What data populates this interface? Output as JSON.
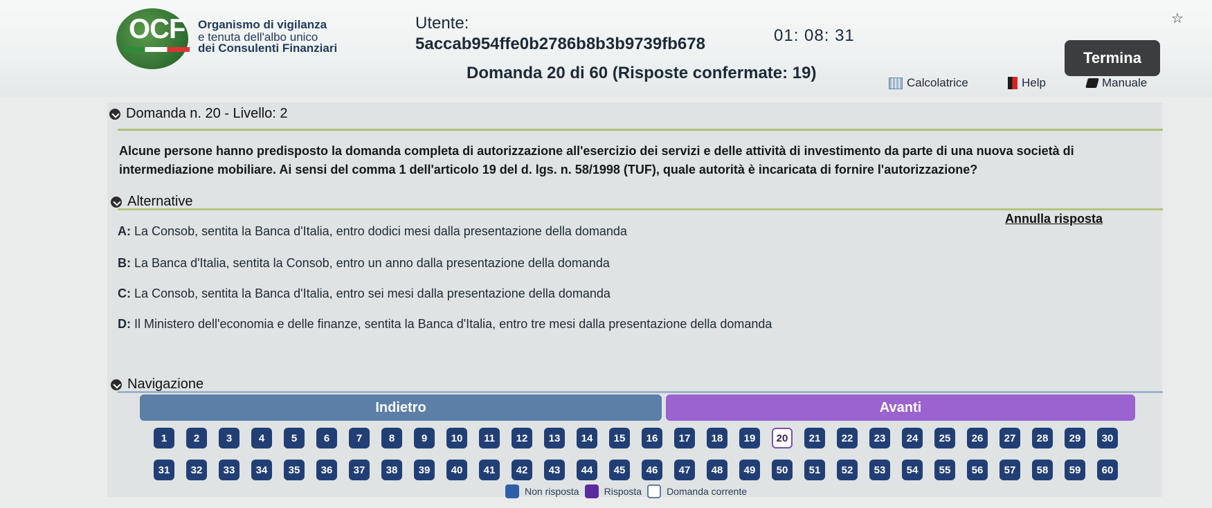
{
  "header": {
    "logo_text": "OCF",
    "org_line1": "Organismo di vigilanza",
    "org_line2": "e tenuta dell'albo unico",
    "org_line3": "dei Consulenti Finanziari",
    "user_label": "Utente:",
    "user_id": "5accab954ffe0b2786b8b3b9739fb678",
    "timer": "01: 08: 31",
    "question_count": "Domanda 20 di 60 (Risposte confermate: 19)",
    "termina_label": "Termina",
    "tools": {
      "calculator": "Calcolatrice",
      "help": "Help",
      "manual": "Manuale"
    }
  },
  "question": {
    "title": "Domanda n. 20 - Livello: 2",
    "text": "Alcune persone hanno predisposto la domanda completa di autorizzazione all'esercizio dei servizi e delle attività di investimento da parte di una nuova società di intermediazione mobiliare. Ai sensi del comma 1 dell'articolo 19 del d. lgs. n. 58/1998 (TUF), quale autorità è incaricata di fornire l'autorizzazione?"
  },
  "alternatives": {
    "title": "Alternative",
    "cancel_label": "Annulla risposta",
    "options": [
      {
        "letter": "A:",
        "text": "La Consob, sentita la Banca d'Italia, entro dodici mesi dalla presentazione della domanda"
      },
      {
        "letter": "B:",
        "text": "La Banca d'Italia, sentita la Consob, entro un anno dalla presentazione della domanda"
      },
      {
        "letter": "C:",
        "text": "La Consob, sentita la Banca d'Italia, entro sei mesi dalla presentazione della domanda"
      },
      {
        "letter": "D:",
        "text": "Il Ministero dell'economia e delle finanze, sentita la Banca d'Italia, entro tre mesi dalla presentazione della domanda"
      }
    ]
  },
  "navigation": {
    "title": "Navigazione",
    "back_label": "Indietro",
    "next_label": "Avanti",
    "current": 20,
    "legend": {
      "not_answered": "Non risposta",
      "answered": "Risposta",
      "current": "Domanda corrente"
    }
  }
}
